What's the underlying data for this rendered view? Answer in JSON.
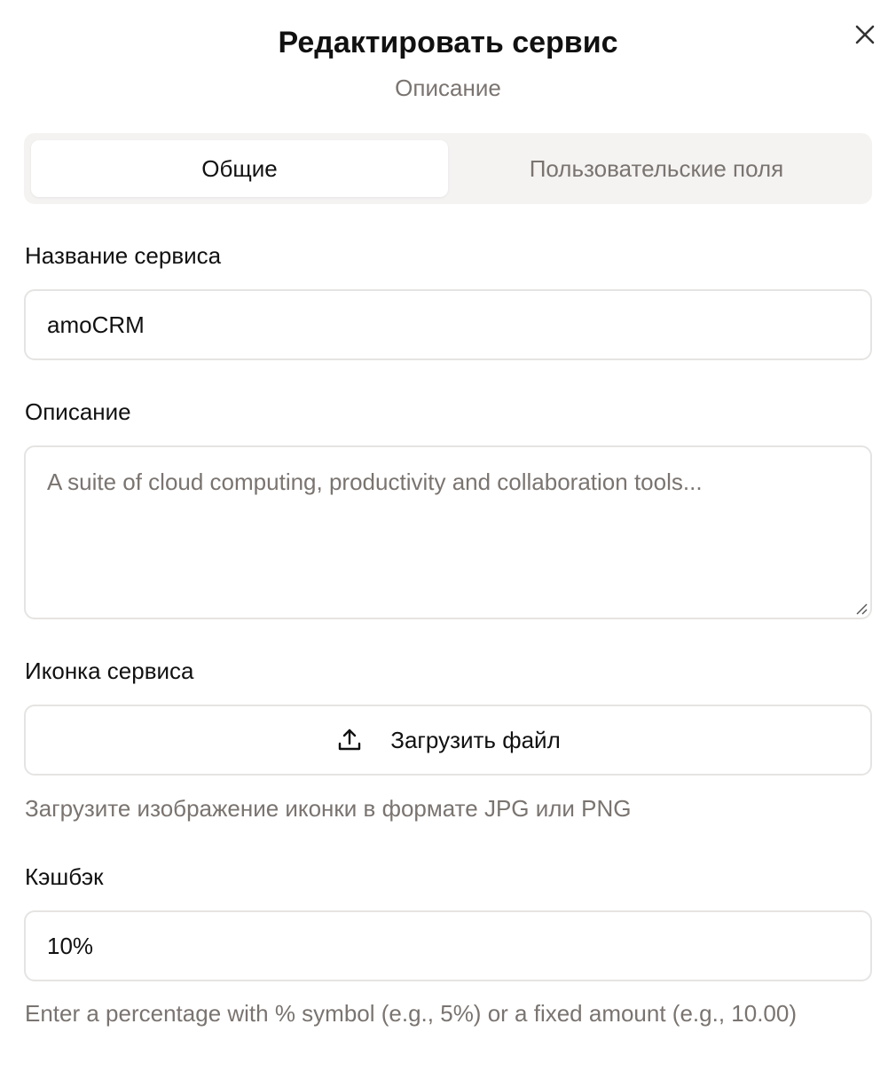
{
  "dialog": {
    "title": "Редактировать сервис",
    "subtitle": "Описание",
    "close_icon": "close-icon"
  },
  "tabs": [
    {
      "label": "Общие",
      "active": true
    },
    {
      "label": "Пользовательские поля",
      "active": false
    }
  ],
  "form": {
    "name": {
      "label": "Название сервиса",
      "value": "amoCRM"
    },
    "description": {
      "label": "Описание",
      "value": "",
      "placeholder": "A suite of cloud computing, productivity and collaboration tools..."
    },
    "icon": {
      "label": "Иконка сервиса",
      "upload_label": "Загрузить файл",
      "upload_icon": "upload-icon",
      "hint": "Загрузите изображение иконки в формате JPG или PNG"
    },
    "cashback": {
      "label": "Кэшбэк",
      "value": "10%",
      "hint": "Enter a percentage with % symbol (e.g., 5%) or a fixed amount (e.g., 10.00)"
    }
  },
  "colors": {
    "text": "#111111",
    "muted": "#7a7470",
    "border": "#e6e4e2",
    "tabs_bg": "#f4f3f2"
  }
}
